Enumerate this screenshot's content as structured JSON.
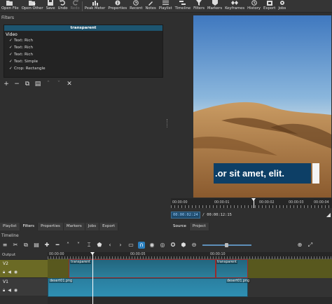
{
  "toolbar": {
    "items": [
      {
        "label": "Open File",
        "icon": "folder-open-icon"
      },
      {
        "label": "Open Other",
        "icon": "open-other-icon"
      },
      {
        "label": "Save",
        "icon": "save-icon"
      },
      {
        "label": "Undo",
        "icon": "undo-icon"
      },
      {
        "label": "Redo",
        "icon": "redo-icon"
      },
      {
        "label": "Peak Meter",
        "icon": "peak-meter-icon"
      },
      {
        "label": "Properties",
        "icon": "properties-icon"
      },
      {
        "label": "Recent",
        "icon": "recent-icon"
      },
      {
        "label": "Notes",
        "icon": "notes-icon"
      },
      {
        "label": "Playlist",
        "icon": "playlist-icon"
      },
      {
        "label": "Timeline",
        "icon": "timeline-icon"
      },
      {
        "label": "Filters",
        "icon": "filters-icon"
      },
      {
        "label": "Markers",
        "icon": "markers-icon"
      },
      {
        "label": "Keyframes",
        "icon": "keyframes-icon"
      },
      {
        "label": "History",
        "icon": "history-icon"
      },
      {
        "label": "Export",
        "icon": "export-icon"
      },
      {
        "label": "Jobs",
        "icon": "jobs-icon"
      }
    ]
  },
  "filters": {
    "title": "Filters",
    "clip_name": "transparent",
    "group": "Video",
    "items": [
      "Text: Rich",
      "Text: Rich",
      "Text: Rich",
      "Text: Simple",
      "Crop: Rectangle"
    ]
  },
  "player": {
    "caption_text": ".or sit amet, elit.",
    "ruler_ticks": [
      "00:00:00",
      "00:00:01",
      "00:00:02",
      "00:00:03",
      "00:00:04"
    ],
    "current_time": "00:00:02:24",
    "total_time": "/ 00:00:12:15"
  },
  "tabs_left": [
    "Playlist",
    "Filters",
    "Properties",
    "Markers",
    "Jobs",
    "Export"
  ],
  "tabs_right": [
    "Source",
    "Project"
  ],
  "timeline": {
    "title": "Timeline",
    "output_label": "Output",
    "ruler_ticks": [
      "00:00:00",
      "00:00:05",
      "00:00:10"
    ],
    "tracks": [
      {
        "name": "V2",
        "clip_left": "transparent",
        "clip_right": "transparent"
      },
      {
        "name": "V1",
        "clip_left": "desert01.png",
        "clip_right": "desert01.png"
      }
    ]
  },
  "colors": {
    "accent": "#2a7fbf",
    "caption_bg": "#0d3f66",
    "selected_track": "#6b6a25"
  }
}
